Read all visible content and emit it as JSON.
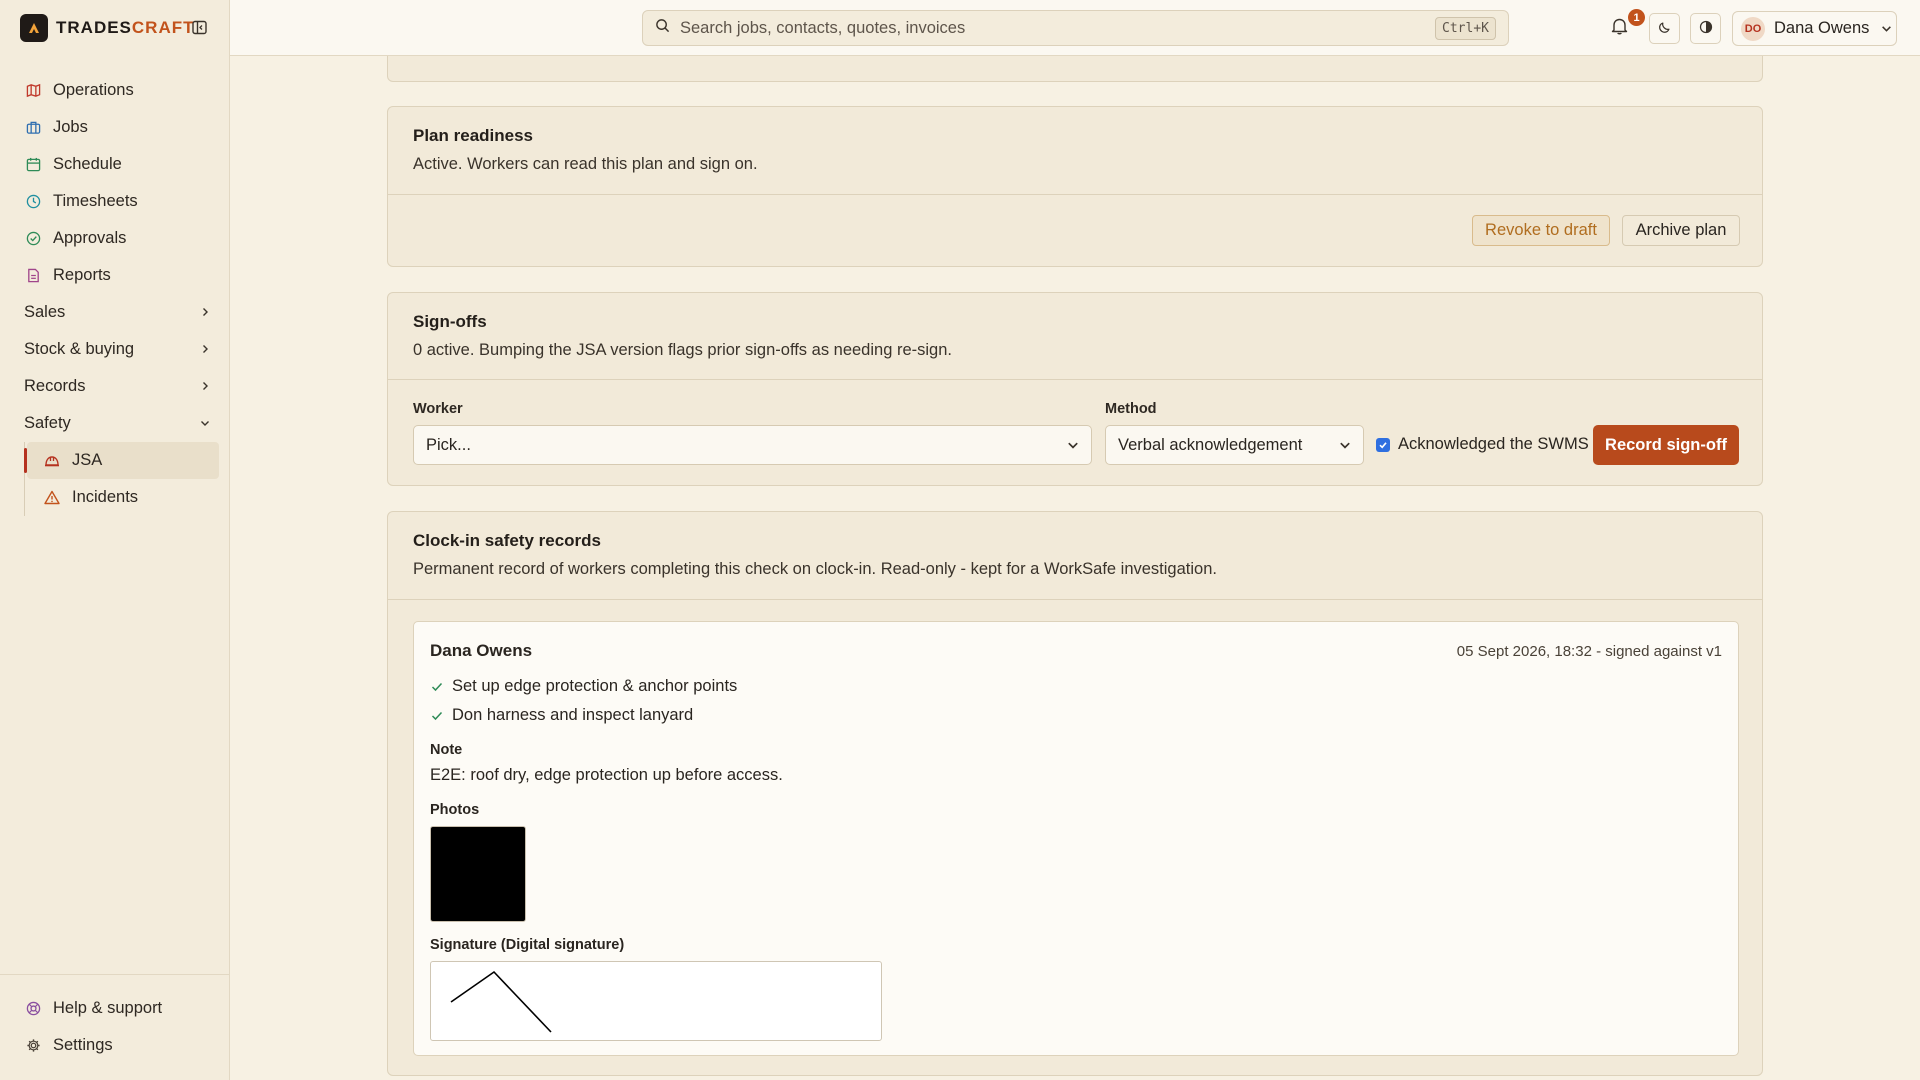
{
  "brand": {
    "name_part1": "TRADES",
    "name_part2": "CRAFT"
  },
  "sidebar": {
    "items": [
      {
        "label": "Operations",
        "icon": "map-icon",
        "color": "#c0392b"
      },
      {
        "label": "Jobs",
        "icon": "briefcase-icon",
        "color": "#2f6fb0"
      },
      {
        "label": "Schedule",
        "icon": "calendar-icon",
        "color": "#2e8b57"
      },
      {
        "label": "Timesheets",
        "icon": "clock-icon",
        "color": "#1f8fa0"
      },
      {
        "label": "Approvals",
        "icon": "check-circle-icon",
        "color": "#2e8b57"
      },
      {
        "label": "Reports",
        "icon": "document-icon",
        "color": "#a0458a"
      }
    ],
    "groups": [
      {
        "label": "Sales"
      },
      {
        "label": "Stock & buying"
      },
      {
        "label": "Records"
      },
      {
        "label": "Safety"
      }
    ],
    "safety_items": [
      {
        "label": "JSA",
        "icon": "hard-hat-icon"
      },
      {
        "label": "Incidents",
        "icon": "warning-icon"
      }
    ],
    "footer": [
      {
        "label": "Help & support",
        "icon": "lifebuoy-icon"
      },
      {
        "label": "Settings",
        "icon": "gear-icon"
      }
    ]
  },
  "topbar": {
    "search_placeholder": "Search jobs, contacts, quotes, invoices",
    "shortcut": "Ctrl+K",
    "notification_count": "1",
    "user_initials": "DO",
    "user_name": "Dana Owens"
  },
  "plan_readiness": {
    "title": "Plan readiness",
    "description": "Active. Workers can read this plan and sign on.",
    "revoke_label": "Revoke to draft",
    "archive_label": "Archive plan"
  },
  "signoffs": {
    "title": "Sign-offs",
    "description": "0 active. Bumping the JSA version flags prior sign-offs as needing re-sign.",
    "worker_label": "Worker",
    "worker_value": "Pick...",
    "method_label": "Method",
    "method_value": "Verbal acknowledgement",
    "ack_label": "Acknowledged the SWMS",
    "ack_checked": true,
    "record_label": "Record sign-off"
  },
  "clockin": {
    "title": "Clock-in safety records",
    "description": "Permanent record of workers completing this check on clock-in. Read-only - kept for a WorkSafe investigation.",
    "record": {
      "name": "Dana Owens",
      "meta": "05 Sept 2026, 18:32 - signed against v1",
      "checks": [
        "Set up edge protection & anchor points",
        "Don harness and inspect lanyard"
      ],
      "note_label": "Note",
      "note": "E2E: roof dry, edge protection up before access.",
      "photos_label": "Photos",
      "signature_label": "Signature (Digital signature)"
    }
  },
  "colors": {
    "accent": "#b84a1c",
    "active_marker": "#b5321f",
    "background": "#f7f1e3"
  }
}
